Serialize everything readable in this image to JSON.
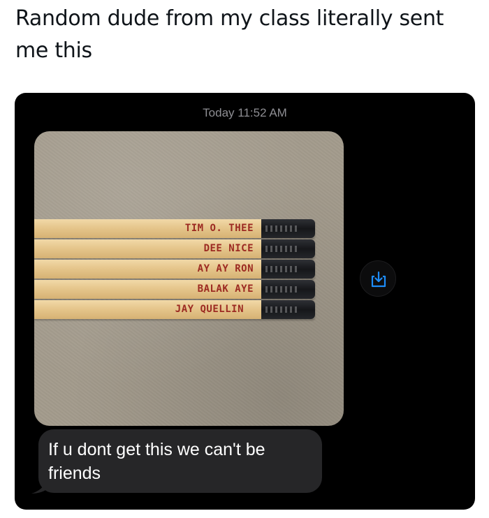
{
  "post": {
    "caption": "Random dude from my class literally sent me this"
  },
  "chat": {
    "timestamp": "Today 11:52 AM",
    "message": "If u dont get this we can't be friends",
    "pencils": [
      {
        "name": "TIM O. THEE"
      },
      {
        "name": "DEE NICE"
      },
      {
        "name": "AY AY RON"
      },
      {
        "name": "BALAK AYE"
      },
      {
        "name": "JAY QUELLIN"
      }
    ],
    "share_icon": "share-download-icon"
  },
  "colors": {
    "chat_background": "#000000",
    "bubble": "#262628",
    "share_icon_accent": "#1d8cf8",
    "pencil_text": "#9c2a22"
  }
}
